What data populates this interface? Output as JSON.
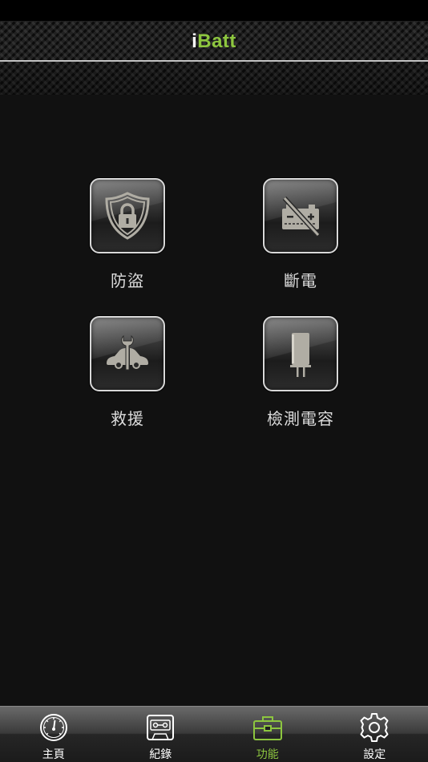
{
  "app": {
    "title_prefix": "i",
    "title_rest": "Batt"
  },
  "colors": {
    "accent": "#8dc63f",
    "background": "#111111",
    "icon_gray": "#b0ada4"
  },
  "features": [
    {
      "label": "防盜",
      "icon": "shield-lock-icon"
    },
    {
      "label": "斷電",
      "icon": "battery-off-icon"
    },
    {
      "label": "救援",
      "icon": "car-wrench-icon"
    },
    {
      "label": "檢測電容",
      "icon": "capacitor-icon"
    }
  ],
  "tabs": [
    {
      "label": "主頁",
      "icon": "gauge-icon",
      "active": false
    },
    {
      "label": "紀錄",
      "icon": "cassette-icon",
      "active": false
    },
    {
      "label": "功能",
      "icon": "toolbox-icon",
      "active": true
    },
    {
      "label": "設定",
      "icon": "gear-icon",
      "active": false
    }
  ]
}
